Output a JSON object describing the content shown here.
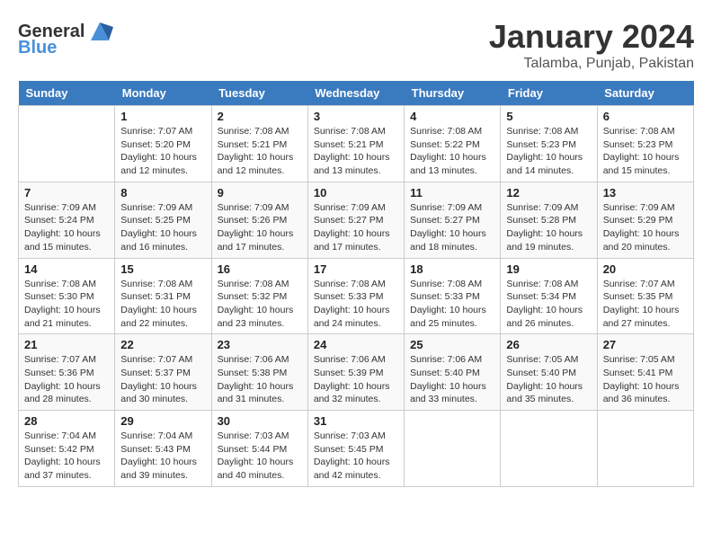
{
  "header": {
    "logo": {
      "general": "General",
      "blue": "Blue"
    },
    "title": "January 2024",
    "location": "Talamba, Punjab, Pakistan"
  },
  "calendar": {
    "days_of_week": [
      "Sunday",
      "Monday",
      "Tuesday",
      "Wednesday",
      "Thursday",
      "Friday",
      "Saturday"
    ],
    "weeks": [
      [
        {
          "day": "",
          "info": ""
        },
        {
          "day": "1",
          "info": "Sunrise: 7:07 AM\nSunset: 5:20 PM\nDaylight: 10 hours\nand 12 minutes."
        },
        {
          "day": "2",
          "info": "Sunrise: 7:08 AM\nSunset: 5:21 PM\nDaylight: 10 hours\nand 12 minutes."
        },
        {
          "day": "3",
          "info": "Sunrise: 7:08 AM\nSunset: 5:21 PM\nDaylight: 10 hours\nand 13 minutes."
        },
        {
          "day": "4",
          "info": "Sunrise: 7:08 AM\nSunset: 5:22 PM\nDaylight: 10 hours\nand 13 minutes."
        },
        {
          "day": "5",
          "info": "Sunrise: 7:08 AM\nSunset: 5:23 PM\nDaylight: 10 hours\nand 14 minutes."
        },
        {
          "day": "6",
          "info": "Sunrise: 7:08 AM\nSunset: 5:23 PM\nDaylight: 10 hours\nand 15 minutes."
        }
      ],
      [
        {
          "day": "7",
          "info": "Sunrise: 7:09 AM\nSunset: 5:24 PM\nDaylight: 10 hours\nand 15 minutes."
        },
        {
          "day": "8",
          "info": "Sunrise: 7:09 AM\nSunset: 5:25 PM\nDaylight: 10 hours\nand 16 minutes."
        },
        {
          "day": "9",
          "info": "Sunrise: 7:09 AM\nSunset: 5:26 PM\nDaylight: 10 hours\nand 17 minutes."
        },
        {
          "day": "10",
          "info": "Sunrise: 7:09 AM\nSunset: 5:27 PM\nDaylight: 10 hours\nand 17 minutes."
        },
        {
          "day": "11",
          "info": "Sunrise: 7:09 AM\nSunset: 5:27 PM\nDaylight: 10 hours\nand 18 minutes."
        },
        {
          "day": "12",
          "info": "Sunrise: 7:09 AM\nSunset: 5:28 PM\nDaylight: 10 hours\nand 19 minutes."
        },
        {
          "day": "13",
          "info": "Sunrise: 7:09 AM\nSunset: 5:29 PM\nDaylight: 10 hours\nand 20 minutes."
        }
      ],
      [
        {
          "day": "14",
          "info": "Sunrise: 7:08 AM\nSunset: 5:30 PM\nDaylight: 10 hours\nand 21 minutes."
        },
        {
          "day": "15",
          "info": "Sunrise: 7:08 AM\nSunset: 5:31 PM\nDaylight: 10 hours\nand 22 minutes."
        },
        {
          "day": "16",
          "info": "Sunrise: 7:08 AM\nSunset: 5:32 PM\nDaylight: 10 hours\nand 23 minutes."
        },
        {
          "day": "17",
          "info": "Sunrise: 7:08 AM\nSunset: 5:33 PM\nDaylight: 10 hours\nand 24 minutes."
        },
        {
          "day": "18",
          "info": "Sunrise: 7:08 AM\nSunset: 5:33 PM\nDaylight: 10 hours\nand 25 minutes."
        },
        {
          "day": "19",
          "info": "Sunrise: 7:08 AM\nSunset: 5:34 PM\nDaylight: 10 hours\nand 26 minutes."
        },
        {
          "day": "20",
          "info": "Sunrise: 7:07 AM\nSunset: 5:35 PM\nDaylight: 10 hours\nand 27 minutes."
        }
      ],
      [
        {
          "day": "21",
          "info": "Sunrise: 7:07 AM\nSunset: 5:36 PM\nDaylight: 10 hours\nand 28 minutes."
        },
        {
          "day": "22",
          "info": "Sunrise: 7:07 AM\nSunset: 5:37 PM\nDaylight: 10 hours\nand 30 minutes."
        },
        {
          "day": "23",
          "info": "Sunrise: 7:06 AM\nSunset: 5:38 PM\nDaylight: 10 hours\nand 31 minutes."
        },
        {
          "day": "24",
          "info": "Sunrise: 7:06 AM\nSunset: 5:39 PM\nDaylight: 10 hours\nand 32 minutes."
        },
        {
          "day": "25",
          "info": "Sunrise: 7:06 AM\nSunset: 5:40 PM\nDaylight: 10 hours\nand 33 minutes."
        },
        {
          "day": "26",
          "info": "Sunrise: 7:05 AM\nSunset: 5:40 PM\nDaylight: 10 hours\nand 35 minutes."
        },
        {
          "day": "27",
          "info": "Sunrise: 7:05 AM\nSunset: 5:41 PM\nDaylight: 10 hours\nand 36 minutes."
        }
      ],
      [
        {
          "day": "28",
          "info": "Sunrise: 7:04 AM\nSunset: 5:42 PM\nDaylight: 10 hours\nand 37 minutes."
        },
        {
          "day": "29",
          "info": "Sunrise: 7:04 AM\nSunset: 5:43 PM\nDaylight: 10 hours\nand 39 minutes."
        },
        {
          "day": "30",
          "info": "Sunrise: 7:03 AM\nSunset: 5:44 PM\nDaylight: 10 hours\nand 40 minutes."
        },
        {
          "day": "31",
          "info": "Sunrise: 7:03 AM\nSunset: 5:45 PM\nDaylight: 10 hours\nand 42 minutes."
        },
        {
          "day": "",
          "info": ""
        },
        {
          "day": "",
          "info": ""
        },
        {
          "day": "",
          "info": ""
        }
      ]
    ]
  }
}
